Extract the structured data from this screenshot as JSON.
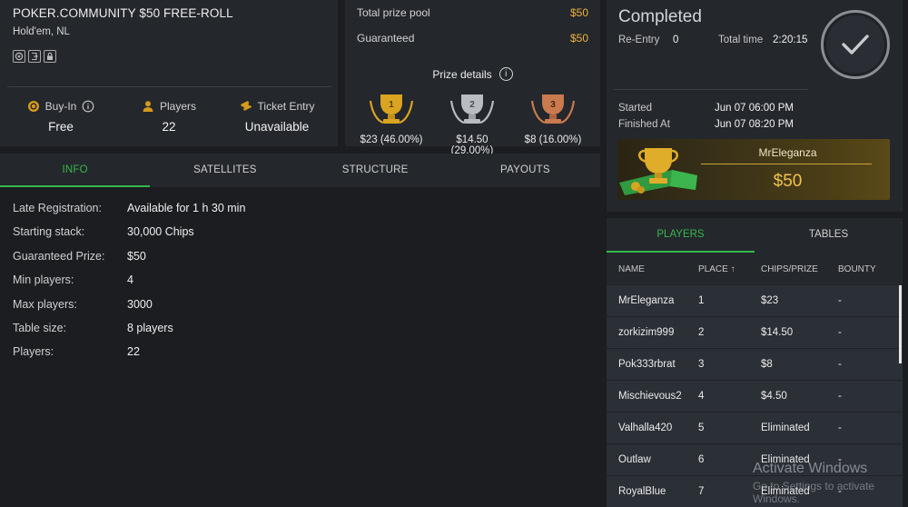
{
  "tournament": {
    "title": "POKER.COMMUNITY $50 FREE-ROLL",
    "game": "Hold'em, NL",
    "feature_icons": [
      "target-icon",
      "rebuy-icon",
      "lock-icon"
    ],
    "buyin": {
      "label": "Buy-In",
      "value": "Free"
    },
    "players": {
      "label": "Players",
      "value": "22"
    },
    "ticket": {
      "label": "Ticket Entry",
      "value": "Unavailable"
    }
  },
  "prize": {
    "total_label": "Total prize pool",
    "total_value": "$50",
    "guaranteed_label": "Guaranteed",
    "guaranteed_value": "$50",
    "details_label": "Prize details",
    "places": [
      {
        "rank": "1",
        "amount": "$23 (46.00%)",
        "color": "#d9a521"
      },
      {
        "rank": "2",
        "amount": "$14.50 (29.00%)",
        "color": "#b9bcc0"
      },
      {
        "rank": "3",
        "amount": "$8 (16.00%)",
        "color": "#c97a4e"
      }
    ]
  },
  "status": {
    "title": "Completed",
    "reentry_label": "Re-Entry",
    "reentry_value": "0",
    "total_time_label": "Total time",
    "total_time_value": "2:20:15",
    "started_label": "Started",
    "started_value": "Jun 07 06:00 PM",
    "finished_label": "Finished At",
    "finished_value": "Jun 07 08:20 PM",
    "winner_name": "MrEleganza",
    "winner_prize": "$50"
  },
  "tabs": [
    "INFO",
    "SATELLITES",
    "STRUCTURE",
    "PAYOUTS"
  ],
  "info": [
    {
      "label": "Late Registration:",
      "value": "Available for 1 h 30 min"
    },
    {
      "label": "Starting stack:",
      "value": "30,000 Chips"
    },
    {
      "label": "Guaranteed Prize:",
      "value": "$50"
    },
    {
      "label": "Min players:",
      "value": "4"
    },
    {
      "label": "Max players:",
      "value": "3000"
    },
    {
      "label": "Table size:",
      "value": "8 players"
    },
    {
      "label": "Players:",
      "value": "22"
    }
  ],
  "players_panel": {
    "tabs": [
      "PLAYERS",
      "TABLES"
    ],
    "columns": [
      "NAME",
      "PLACE ↑",
      "CHIPS/PRIZE",
      "BOUNTY"
    ],
    "rows": [
      {
        "name": "MrEleganza",
        "place": "1",
        "prize": "$23",
        "bounty": "-"
      },
      {
        "name": "zorkizim999",
        "place": "2",
        "prize": "$14.50",
        "bounty": "-"
      },
      {
        "name": "Pok333rbrat",
        "place": "3",
        "prize": "$8",
        "bounty": "-"
      },
      {
        "name": "Mischievous2",
        "place": "4",
        "prize": "$4.50",
        "bounty": "-"
      },
      {
        "name": "Valhalla420",
        "place": "5",
        "prize": "Eliminated",
        "bounty": "-"
      },
      {
        "name": "Outlaw",
        "place": "6",
        "prize": "Eliminated",
        "bounty": "-"
      },
      {
        "name": "RoyalBlue",
        "place": "7",
        "prize": "Eliminated",
        "bounty": "-"
      }
    ]
  },
  "watermark": {
    "line1": "Activate Windows",
    "line2": "Go to Settings to activate Windows."
  },
  "colors": {
    "accent_green": "#35b84d",
    "prize_gold": "#f0b13a",
    "panel": "#24272c",
    "background": "#1b1d21"
  }
}
